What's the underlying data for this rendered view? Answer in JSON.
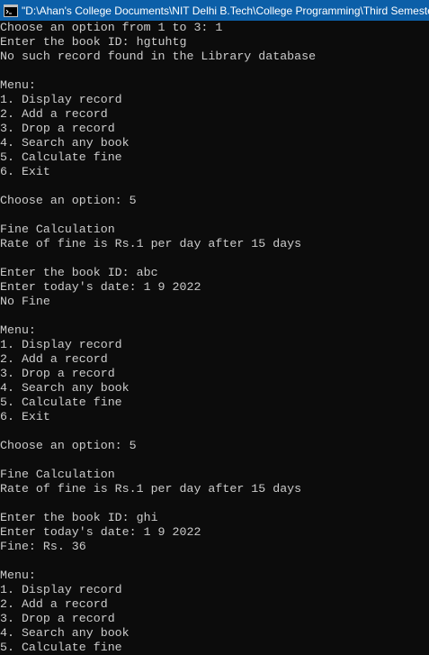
{
  "window": {
    "title": "\"D:\\Ahan's College Documents\\NIT Delhi B.Tech\\College Programming\\Third Semeste",
    "icon": "console-app-icon"
  },
  "console": {
    "lines": [
      "Choose an option from 1 to 3: 1",
      "Enter the book ID: hgtuhtg",
      "No such record found in the Library database",
      "",
      "Menu:",
      "1. Display record",
      "2. Add a record",
      "3. Drop a record",
      "4. Search any book",
      "5. Calculate fine",
      "6. Exit",
      "",
      "Choose an option: 5",
      "",
      "Fine Calculation",
      "Rate of fine is Rs.1 per day after 15 days",
      "",
      "Enter the book ID: abc",
      "Enter today's date: 1 9 2022",
      "No Fine",
      "",
      "Menu:",
      "1. Display record",
      "2. Add a record",
      "3. Drop a record",
      "4. Search any book",
      "5. Calculate fine",
      "6. Exit",
      "",
      "Choose an option: 5",
      "",
      "Fine Calculation",
      "Rate of fine is Rs.1 per day after 15 days",
      "",
      "Enter the book ID: ghi",
      "Enter today's date: 1 9 2022",
      "Fine: Rs. 36",
      "",
      "Menu:",
      "1. Display record",
      "2. Add a record",
      "3. Drop a record",
      "4. Search any book",
      "5. Calculate fine"
    ]
  },
  "colors": {
    "titlebar": "#0c5fa8",
    "background": "#0c0c0c",
    "text": "#cccccc"
  }
}
